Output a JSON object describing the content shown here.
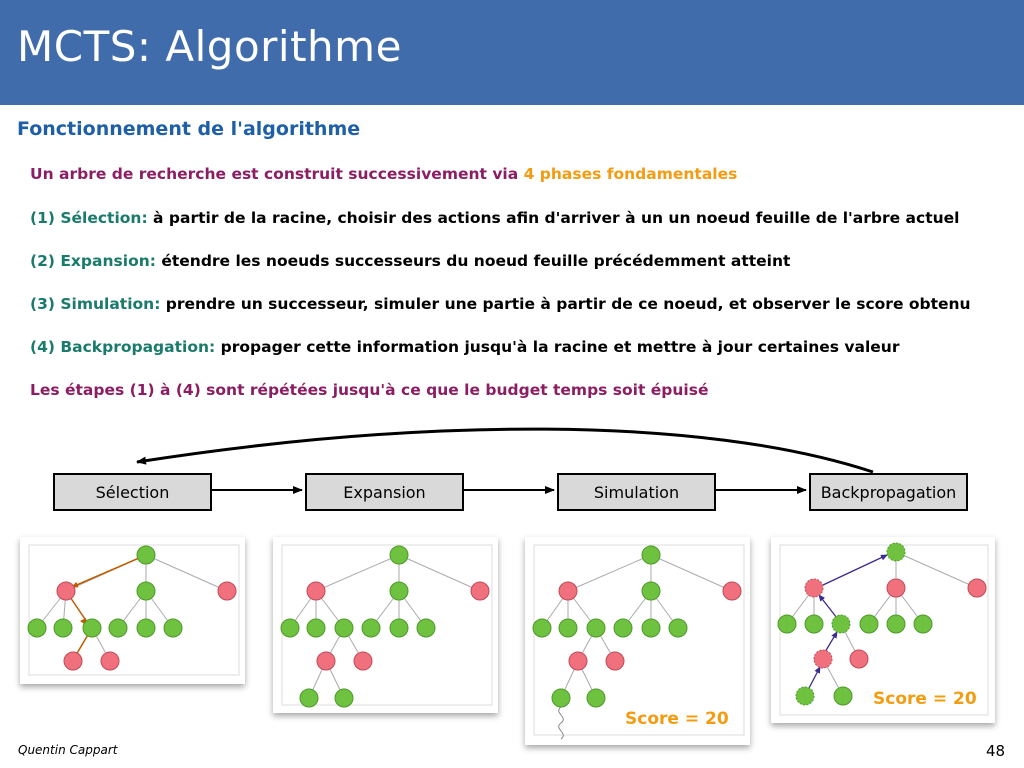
{
  "title": "MCTS: Algorithme",
  "section_heading": "Fonctionnement de l'algorithme",
  "intro": {
    "text": "Un arbre de recherche est construit successivement via ",
    "highlight": "4 phases fondamentales"
  },
  "steps": [
    {
      "label": "(1) Sélection:",
      "text": " à partir de la racine, choisir des actions afin d'arriver à un un noeud feuille de l'arbre actuel"
    },
    {
      "label": "(2) Expansion:",
      "text": " étendre les noeuds successeurs du noeud feuille précédemment atteint"
    },
    {
      "label": "(3) Simulation:",
      "text": " prendre un successeur, simuler une partie à partir de ce noeud, et observer le score obtenu"
    },
    {
      "label": "(4) Backpropagation:",
      "text": " propager cette information jusqu'à la racine et mettre à jour certaines valeur"
    }
  ],
  "repeat_note": "Les étapes (1) à (4) sont répétées jusqu'à ce que le budget temps soit épuisé",
  "phases": [
    "Sélection",
    "Expansion",
    "Simulation",
    "Backpropagation"
  ],
  "score_labels": [
    "Score = 20",
    "Score = 20"
  ],
  "footer": {
    "author": "Quentin Cappart",
    "page": "48"
  },
  "colors": {
    "title_bar": "#416cab",
    "heading": "#1f5fa6",
    "purple": "#8b1e63",
    "orange": "#f39c12",
    "teal": "#1a7a6b",
    "node_green": "#6fc23f",
    "node_red": "#f0707e"
  }
}
